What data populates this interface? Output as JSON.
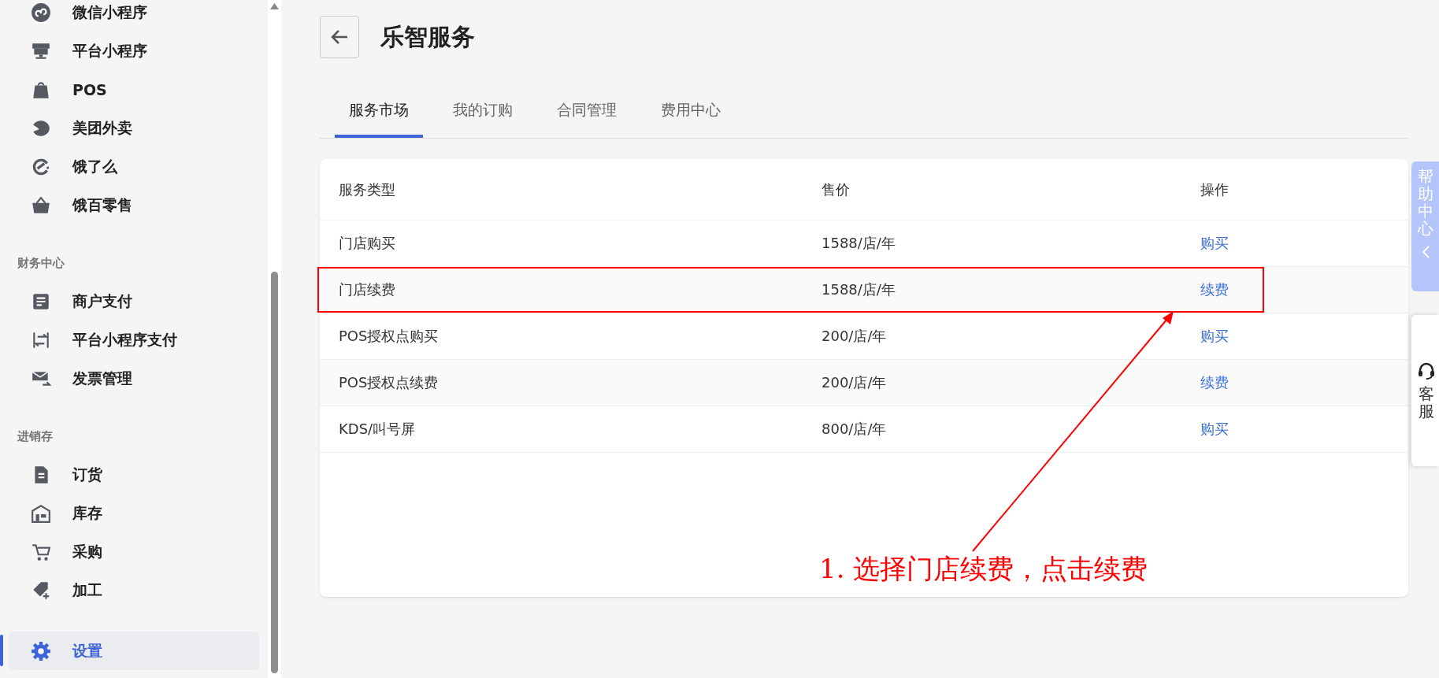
{
  "sidebar": {
    "groups": [
      {
        "items": [
          {
            "label": "微信小程序",
            "selected": false
          },
          {
            "label": "平台小程序",
            "selected": false
          },
          {
            "label": "POS",
            "selected": false
          },
          {
            "label": "美团外卖",
            "selected": false
          },
          {
            "label": "饿了么",
            "selected": false
          },
          {
            "label": "饿百零售",
            "selected": false
          }
        ]
      },
      {
        "heading": "财务中心",
        "items": [
          {
            "label": "商户支付",
            "selected": false
          },
          {
            "label": "平台小程序支付",
            "selected": false
          },
          {
            "label": "发票管理",
            "selected": false
          }
        ]
      },
      {
        "heading": "进销存",
        "items": [
          {
            "label": "订货",
            "selected": false
          },
          {
            "label": "库存",
            "selected": false
          },
          {
            "label": "采购",
            "selected": false
          },
          {
            "label": "加工",
            "selected": false
          }
        ]
      },
      {
        "items": [
          {
            "label": "设置",
            "selected": true
          }
        ]
      }
    ]
  },
  "page": {
    "title": "乐智服务"
  },
  "tabs": [
    {
      "label": "服务市场",
      "selected": true
    },
    {
      "label": "我的订购",
      "selected": false
    },
    {
      "label": "合同管理",
      "selected": false
    },
    {
      "label": "费用中心",
      "selected": false
    }
  ],
  "table": {
    "columns": [
      "服务类型",
      "售价",
      "操作"
    ],
    "rows": [
      {
        "service": "门店购买",
        "price": "1588/店/年",
        "action": "购买",
        "highlighted": false
      },
      {
        "service": "门店续费",
        "price": "1588/店/年",
        "action": "续费",
        "highlighted": true
      },
      {
        "service": "POS授权点购买",
        "price": "200/店/年",
        "action": "购买",
        "highlighted": false
      },
      {
        "service": "POS授权点续费",
        "price": "200/店/年",
        "action": "续费",
        "highlighted": false
      },
      {
        "service": "KDS/叫号屏",
        "price": "800/店/年",
        "action": "购买",
        "highlighted": false
      }
    ]
  },
  "help_tab": {
    "label": "帮助中心"
  },
  "customer_service": {
    "label": "客服"
  },
  "annotation": {
    "text": "1. 选择门店续费，点击续费"
  }
}
